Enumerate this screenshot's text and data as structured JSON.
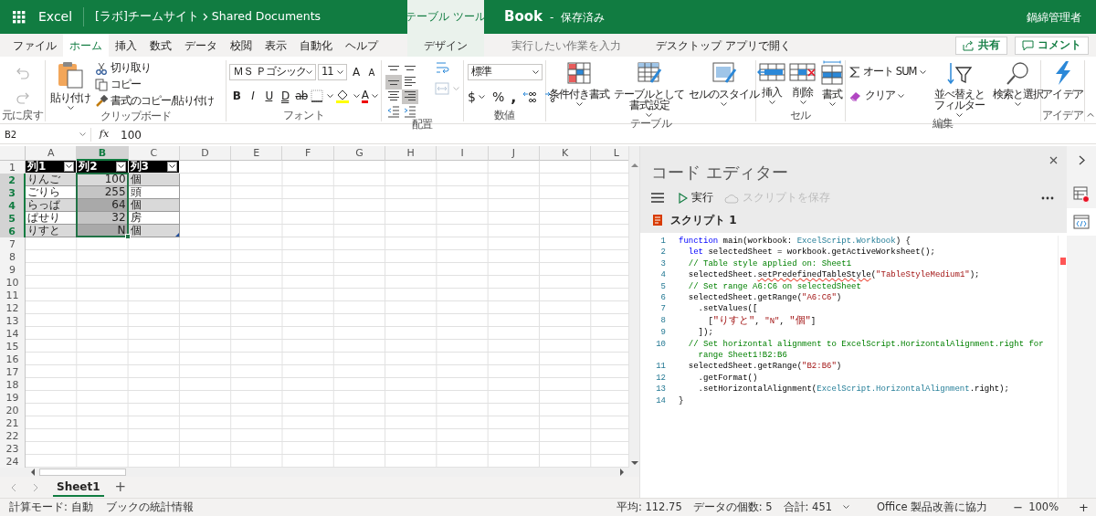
{
  "title_bar": {
    "app_name": "Excel",
    "breadcrumb": [
      "[ラボ]チームサイト",
      "Shared Documents"
    ],
    "context_label": "テーブル ツール",
    "document": "Book",
    "separator": "-",
    "save_status": "保存済み",
    "user": "鍋綿管理者"
  },
  "tabs": [
    {
      "label": "ファイル",
      "selected": false
    },
    {
      "label": "ホーム",
      "selected": true
    },
    {
      "label": "挿入",
      "selected": false
    },
    {
      "label": "数式",
      "selected": false
    },
    {
      "label": "データ",
      "selected": false
    },
    {
      "label": "校閲",
      "selected": false
    },
    {
      "label": "表示",
      "selected": false
    },
    {
      "label": "自動化",
      "selected": false
    },
    {
      "label": "ヘルプ",
      "selected": false
    }
  ],
  "context_tabs": [
    {
      "label": "デザイン",
      "selected": false
    }
  ],
  "tell_me": {
    "placeholder": "実行したい作業を入力"
  },
  "open_in_desktop": "デスクトップ アプリで開く",
  "share_button": "共有",
  "comment_button": "コメント",
  "ribbon": [
    {
      "label": "元に戻す",
      "buttons": [
        {
          "disabled": true
        },
        {
          "disabled": true
        }
      ]
    },
    {
      "label": "クリップボード",
      "paste": "貼り付け",
      "commands": [
        "切り取り",
        "コピー",
        "書式のコピー/貼り付け"
      ]
    },
    {
      "label": "フォント",
      "font": "ＭＳ Ｐゴシック",
      "size": "11",
      "grow": "A",
      "shrink": "A",
      "styles": [
        "B",
        "I",
        "U",
        "D",
        "ab"
      ],
      "font_color": "A"
    },
    {
      "label": "配置",
      "align_buttons": [
        {
          "selected": false
        },
        {
          "selected": false
        },
        {
          "selected": true
        },
        {
          "selected": false
        },
        {
          "selected": false
        },
        {
          "selected": true
        },
        {
          "selected": false
        },
        {
          "selected": false
        }
      ],
      "extra_buttons": [
        {
          "disabled": false
        },
        {
          "disabled": true
        }
      ]
    },
    {
      "label": "数値",
      "format": "標準",
      "currency": "$",
      "percent": "%",
      "comma": ","
    },
    {
      "label": "テーブル",
      "buttons": [
        "条件付き書式",
        "テーブルとして書式設定",
        "セルのスタイル"
      ]
    },
    {
      "label": "セル",
      "buttons": [
        "挿入",
        "削除",
        "書式"
      ]
    },
    {
      "label": "編集",
      "autosum": "オート SUM",
      "clear": "クリア",
      "buttons": [
        "並べ替えとフィルター",
        "検索と選択"
      ]
    },
    {
      "label": "アイデア",
      "buttons": [
        "アイデア"
      ]
    }
  ],
  "formula_bar": {
    "name_box": "B2",
    "function_label": "fx",
    "value": "100"
  },
  "sheet": {
    "columns": [
      {
        "label": "A",
        "selected": false
      },
      {
        "label": "B",
        "selected": true
      },
      {
        "label": "C",
        "selected": false
      },
      {
        "label": "D",
        "selected": false
      },
      {
        "label": "E",
        "selected": false
      },
      {
        "label": "F",
        "selected": false
      },
      {
        "label": "G",
        "selected": false
      },
      {
        "label": "H",
        "selected": false
      },
      {
        "label": "I",
        "selected": false
      },
      {
        "label": "J",
        "selected": false
      },
      {
        "label": "K",
        "selected": false
      },
      {
        "label": "L",
        "selected": false
      }
    ],
    "rows": [
      {
        "label": "1",
        "selected": false
      },
      {
        "label": "2",
        "selected": true
      },
      {
        "label": "3",
        "selected": true
      },
      {
        "label": "4",
        "selected": true
      },
      {
        "label": "5",
        "selected": true
      },
      {
        "label": "6",
        "selected": true
      },
      {
        "label": "7",
        "selected": false
      },
      {
        "label": "8",
        "selected": false
      },
      {
        "label": "9",
        "selected": false
      },
      {
        "label": "10",
        "selected": false
      },
      {
        "label": "11",
        "selected": false
      },
      {
        "label": "12",
        "selected": false
      },
      {
        "label": "13",
        "selected": false
      },
      {
        "label": "14",
        "selected": false
      },
      {
        "label": "15",
        "selected": false
      },
      {
        "label": "16",
        "selected": false
      },
      {
        "label": "17",
        "selected": false
      },
      {
        "label": "18",
        "selected": false
      },
      {
        "label": "19",
        "selected": false
      },
      {
        "label": "20",
        "selected": false
      },
      {
        "label": "21",
        "selected": false
      },
      {
        "label": "22",
        "selected": false
      },
      {
        "label": "23",
        "selected": false
      },
      {
        "label": "24",
        "selected": false
      }
    ],
    "table": {
      "columns": [
        {
          "label": "列1",
          "right_aligned": false
        },
        {
          "label": "列2",
          "right_aligned": true
        },
        {
          "label": "列3",
          "right_aligned": false
        }
      ],
      "rows": [
        [
          "りんご",
          "100",
          "個"
        ],
        [
          "ごりら",
          "255",
          "頭"
        ],
        [
          "らっぱ",
          "64",
          "個"
        ],
        [
          "ぱせり",
          "32",
          "房"
        ],
        [
          "りすと",
          "N",
          "個"
        ]
      ]
    }
  },
  "sheet_tabs": [
    {
      "label": "Sheet1",
      "selected": true
    }
  ],
  "add_sheet": "+",
  "editor": {
    "title": "コード エディター",
    "run": "実行",
    "save": {
      "label": "スクリプトを保存",
      "disabled": true
    },
    "script_name": "スクリプト 1",
    "lines": [
      {
        "number": "1",
        "tokens": [
          {
            "kind": "keyword",
            "text": "function"
          },
          {
            "kind": "plain",
            "text": " main(workbook: "
          },
          {
            "kind": "type",
            "text": "ExcelScript.Workbook"
          },
          {
            "kind": "plain",
            "text": ") {"
          }
        ]
      },
      {
        "number": "2",
        "tokens": [
          {
            "kind": "keyword",
            "text": "  let"
          },
          {
            "kind": "plain",
            "text": " selectedSheet = workbook.getActiveWorksheet();"
          }
        ]
      },
      {
        "number": "3",
        "tokens": [
          {
            "kind": "comment",
            "text": "  // Table style applied on: Sheet1"
          }
        ]
      },
      {
        "number": "4",
        "tokens": [
          {
            "kind": "plain",
            "text": "  selectedSheet."
          },
          {
            "kind": "flagged",
            "text": "setPredefinedTableStyle"
          },
          {
            "kind": "plain",
            "text": "("
          },
          {
            "kind": "string",
            "text": "\"TableStyleMedium1\""
          },
          {
            "kind": "plain",
            "text": ");"
          }
        ]
      },
      {
        "number": "5",
        "tokens": [
          {
            "kind": "comment",
            "text": "  // Set range A6:C6 on selectedSheet"
          }
        ]
      },
      {
        "number": "6",
        "tokens": [
          {
            "kind": "plain",
            "text": "  selectedSheet.getRange("
          },
          {
            "kind": "string",
            "text": "\"A6:C6\""
          },
          {
            "kind": "plain",
            "text": ")"
          }
        ]
      },
      {
        "number": "7",
        "tokens": [
          {
            "kind": "plain",
            "text": "    .setValues(["
          }
        ]
      },
      {
        "number": "8",
        "tokens": [
          {
            "kind": "plain",
            "text": "      ["
          },
          {
            "kind": "string",
            "text": "\"りすと\""
          },
          {
            "kind": "plain",
            "text": ", "
          },
          {
            "kind": "string",
            "text": "\"N\""
          },
          {
            "kind": "plain",
            "text": ", "
          },
          {
            "kind": "string",
            "text": "\"個\""
          },
          {
            "kind": "plain",
            "text": "]"
          }
        ]
      },
      {
        "number": "9",
        "tokens": [
          {
            "kind": "plain",
            "text": "    ]);"
          }
        ]
      },
      {
        "number": "10",
        "tokens": [
          {
            "kind": "comment",
            "text": "  // Set horizontal alignment to ExcelScript.HorizontalAlignment.right for range Sheet1!B2:B6"
          }
        ]
      },
      {
        "number": "11",
        "tokens": [
          {
            "kind": "plain",
            "text": "  selectedSheet.getRange("
          },
          {
            "kind": "string",
            "text": "\"B2:B6\""
          },
          {
            "kind": "plain",
            "text": ")"
          }
        ]
      },
      {
        "number": "12",
        "tokens": [
          {
            "kind": "plain",
            "text": "    .getFormat()"
          }
        ]
      },
      {
        "number": "13",
        "tokens": [
          {
            "kind": "plain",
            "text": "    .setHorizontalAlignment("
          },
          {
            "kind": "type",
            "text": "ExcelScript.HorizontalAlignment"
          },
          {
            "kind": "plain",
            "text": ".right);"
          }
        ]
      },
      {
        "number": "14",
        "tokens": [
          {
            "kind": "plain",
            "text": "}"
          }
        ]
      }
    ]
  },
  "side_tools": [
    {
      "selected": false
    },
    {
      "selected": true
    }
  ],
  "status_bar": {
    "left": [
      "計算モード: 自動",
      "ブックの統計情報"
    ],
    "stats": [
      "平均: 112.75",
      "データの個数: 5",
      "合計: 451"
    ],
    "feedback": "Office 製品改善に協力",
    "zoom_out": "−",
    "zoom": "100%",
    "zoom_in": "+"
  }
}
